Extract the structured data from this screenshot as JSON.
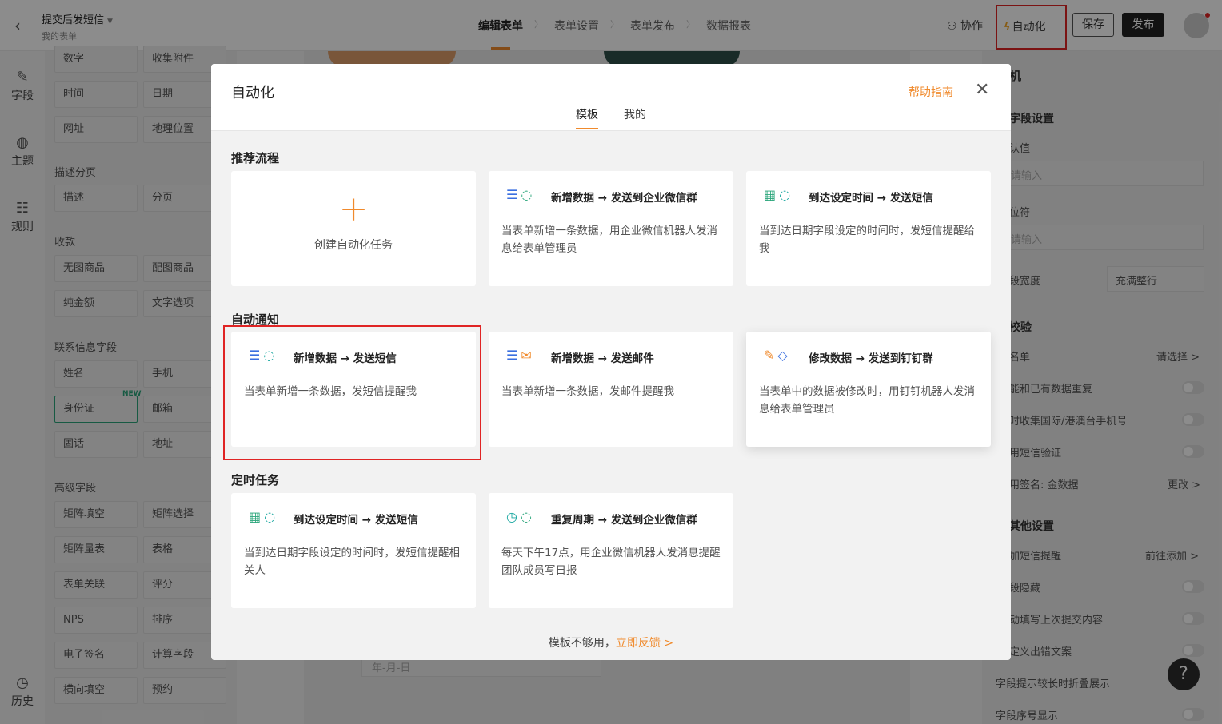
{
  "header": {
    "form_title": "提交后发短信",
    "form_subtitle": "我的表单",
    "steps": [
      "编辑表单",
      "表单设置",
      "表单发布",
      "数据报表"
    ],
    "collab_label": "协作",
    "automation_label": "自动化",
    "save_label": "保存",
    "publish_label": "发布"
  },
  "rail": {
    "fields": "字段",
    "theme": "主题",
    "rules": "规则",
    "history": "历史"
  },
  "panel": {
    "groups": {
      "describe": "描述分页",
      "payment": "收款",
      "contact": "联系信息字段",
      "advanced": "高级字段"
    },
    "buttons": [
      "数字",
      "收集附件",
      "时间",
      "日期",
      "网址",
      "地理位置",
      "描述",
      "分页",
      "无图商品",
      "配图商品",
      "纯金额",
      "文字选项",
      "姓名",
      "手机",
      "身份证",
      "邮箱",
      "固话",
      "地址",
      "矩阵填空",
      "矩阵选择",
      "矩阵量表",
      "表格",
      "表单关联",
      "评分",
      "NPS",
      "排序",
      "电子签名",
      "计算字段",
      "横向填空",
      "预约"
    ],
    "new_tag": "NEW"
  },
  "canvas": {
    "date_placeholder": "年-月-日"
  },
  "right_panel": {
    "title": "机",
    "field_settings": "字段设置",
    "default_value": "认值",
    "placeholder1": "请输入",
    "placeholder_label": "位符",
    "placeholder2": "请输入",
    "width_label": "段宽度",
    "width_value": "充满整行",
    "validation": "校验",
    "list_label": "名单",
    "list_value": "请选择 >",
    "dup": "能和已有数据重复",
    "intl": "时收集国际/港澳台手机号",
    "sms_verify": "用短信验证",
    "sign_label": "用签名: 金数据",
    "sign_value": "更改 >",
    "other": "其他设置",
    "sms_remind": "加短信提醒",
    "sms_remind_value": "前往添加 >",
    "hide": "段隐藏",
    "autofill": "动填写上次提交内容",
    "custom_err": "定义出错文案",
    "fold": "字段提示较长时折叠展示",
    "seq": "字段序号显示"
  },
  "modal": {
    "title": "自动化",
    "tabs": [
      "模板",
      "我的"
    ],
    "help_link": "帮助指南",
    "sections": [
      "推荐流程",
      "自动通知",
      "定时任务"
    ],
    "create_label": "创建自动化任务",
    "cards": [
      {
        "title": "新增数据 → 发送到企业微信群",
        "desc": "当表单新增一条数据，用企业微信机器人发消息给表单管理员"
      },
      {
        "title": "到达设定时间 → 发送短信",
        "desc": "当到达日期字段设定的时间时，发短信提醒给我"
      },
      {
        "title": "新增数据 → 发送短信",
        "desc": "当表单新增一条数据，发短信提醒我"
      },
      {
        "title": "新增数据 → 发送邮件",
        "desc": "当表单新增一条数据，发邮件提醒我"
      },
      {
        "title": "修改数据 → 发送到钉钉群",
        "desc": "当表单中的数据被修改时，用钉钉机器人发消息给表单管理员"
      },
      {
        "title": "到达设定时间 → 发送短信",
        "desc": "当到达日期字段设定的时间时，发短信提醒相关人"
      },
      {
        "title": "重复周期 → 发送到企业微信群",
        "desc": "每天下午17点，用企业微信机器人发消息提醒团队成员写日报"
      }
    ],
    "footer_text": "模板不够用，",
    "footer_link": "立即反馈 >"
  },
  "colors": {
    "accent": "#f08a2c",
    "highlight_border": "#e02424",
    "publish_bg": "#222222"
  }
}
